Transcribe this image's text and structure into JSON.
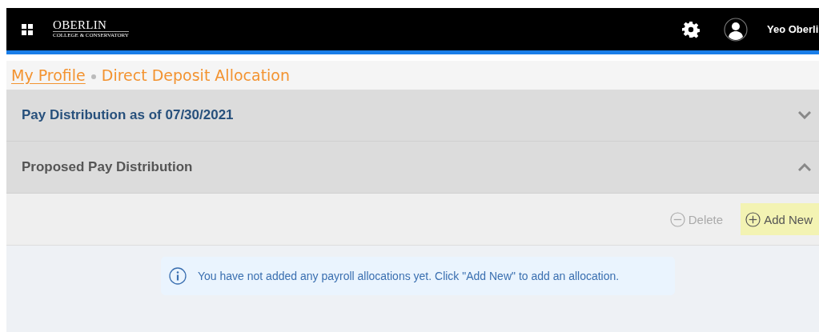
{
  "header": {
    "logo": {
      "title": "OBERLIN",
      "subtitle": "COLLEGE & CONSERVATORY"
    },
    "user_name": "Yeo Oberli"
  },
  "breadcrumb": [
    {
      "label": "My Profile",
      "kind": "link"
    },
    {
      "label": "Direct Deposit Allocation",
      "kind": "current"
    }
  ],
  "sections": [
    {
      "title": "Pay Distribution as of 07/30/2021",
      "expanded": false,
      "kind": "link"
    },
    {
      "title": "Proposed Pay Distribution",
      "expanded": true,
      "kind": "plain"
    }
  ],
  "toolbar": [
    {
      "label": "Delete",
      "kind": "remove",
      "disabled": true,
      "highlighted": false
    },
    {
      "label": "Add New",
      "kind": "add",
      "disabled": false,
      "highlighted": true
    }
  ],
  "notice": "You have not added any payroll allocations yet. Click \"Add New\" to add an allocation."
}
